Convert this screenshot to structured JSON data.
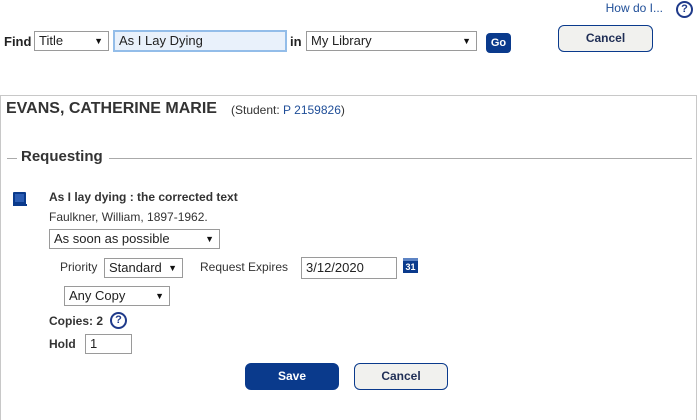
{
  "header": {
    "how_do_i": "How do I...",
    "help_icon_glyph": "?"
  },
  "search": {
    "find_label": "Find",
    "field_selected": "Title",
    "query_value": "As I Lay Dying",
    "in_label": "in",
    "library_selected": "My Library",
    "go_label": "Go",
    "cancel_label": "Cancel"
  },
  "patron": {
    "name": "EVANS, CATHERINE MARIE",
    "student_prefix": "(Student: ",
    "student_id": "P 2159826",
    "student_suffix": ")"
  },
  "request": {
    "section_title": "Requesting",
    "item_icon": "book-icon",
    "title": "As I lay dying : the corrected text",
    "author": "Faulkner, William, 1897-1962.",
    "timing_selected": "As soon as possible",
    "priority_label": "Priority",
    "priority_selected": "Standard",
    "expires_label": "Request Expires",
    "expires_value": "3/12/2020",
    "calendar_glyph": "31",
    "copy_selected": "Any Copy",
    "copies_label": "Copies: 2",
    "hold_label": "Hold",
    "hold_value": "1",
    "save_label": "Save",
    "cancel_label": "Cancel"
  },
  "colors": {
    "accent_blue": "#0a3a8c",
    "link_blue": "#1f4e98",
    "input_focus": "#e9f1fb"
  }
}
